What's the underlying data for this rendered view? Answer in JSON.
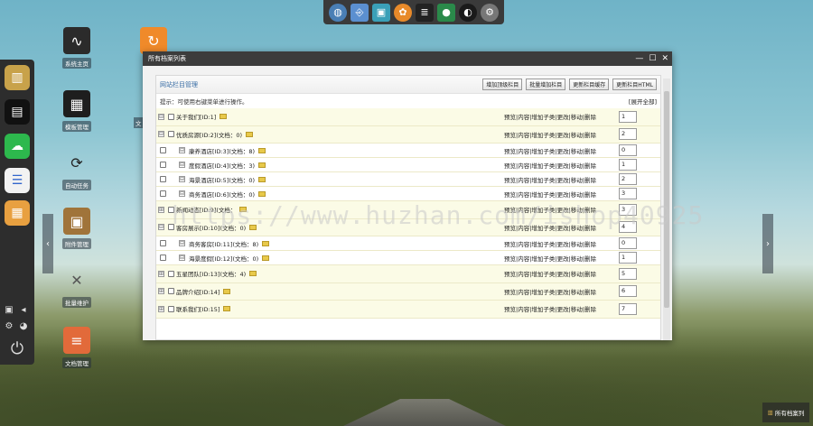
{
  "window": {
    "title": "所有档案列表",
    "controls": [
      "—",
      "☐",
      "✕"
    ]
  },
  "panel": {
    "title": "网站栏目管理",
    "buttons": [
      "增加顶级栏目",
      "批量增加栏目",
      "更新栏目缓存",
      "更新栏目HTML"
    ],
    "hint": "提示：可使用右键菜单进行操作。",
    "expand_all": "[展开全部]"
  },
  "rows": [
    {
      "type": "top",
      "exp": "⊟",
      "label": "关于我们[ID:1]",
      "actions": "预览|内容|增加子类|更改|移动|删除",
      "order": "1"
    },
    {
      "type": "top",
      "exp": "⊟",
      "label": "优质房源[ID:2](文档：0)",
      "actions": "预览|内容|增加子类|更改|移动|删除",
      "order": "2"
    },
    {
      "type": "sub",
      "exp": "⊟",
      "label": "康养酒店[ID:3](文档：8)",
      "actions": "预览|内容|增加子类|更改|移动|删除",
      "order": "0"
    },
    {
      "type": "sub",
      "exp": "⊟",
      "label": "度假酒店[ID:4](文档：3)",
      "actions": "预览|内容|增加子类|更改|移动|删除",
      "order": "1"
    },
    {
      "type": "sub",
      "exp": "⊟",
      "label": "海景酒店[ID:5](文档：0)",
      "actions": "预览|内容|增加子类|更改|移动|删除",
      "order": "2"
    },
    {
      "type": "sub",
      "exp": "⊟",
      "label": "商务酒店[ID:6](文档：0)",
      "actions": "预览|内容|增加子类|更改|移动|删除",
      "order": "3"
    },
    {
      "type": "top",
      "exp": "⊞",
      "label": "新闻动态[ID:9](文档：",
      "actions": "预览|内容|增加子类|更改|移动|删除",
      "order": "3"
    },
    {
      "type": "top",
      "exp": "⊟",
      "label": "客房展示[ID:10](文档：0)",
      "actions": "预览|内容|增加子类|更改|移动|删除",
      "order": "4"
    },
    {
      "type": "sub",
      "exp": "⊟",
      "label": "商务客房[ID:11](文档：8)",
      "actions": "预览|内容|增加子类|更改|移动|删除",
      "order": "0"
    },
    {
      "type": "sub",
      "exp": "⊟",
      "label": "海景度假[ID:12](文档：0)",
      "actions": "预览|内容|增加子类|更改|移动|删除",
      "order": "1"
    },
    {
      "type": "top",
      "exp": "⊞",
      "label": "五星团队[ID:13](文档：4)",
      "actions": "预览|内容|增加子类|更改|移动|删除",
      "order": "5"
    },
    {
      "type": "top",
      "exp": "⊞",
      "label": "品牌介绍[ID:14]",
      "actions": "预览|内容|增加子类|更改|移动|删除",
      "order": "6"
    },
    {
      "type": "top",
      "exp": "⊞",
      "label": "联系我们[ID:15]",
      "actions": "预览|内容|增加子类|更改|移动|删除",
      "order": "7"
    }
  ],
  "desktop": {
    "icons": [
      {
        "label": "系统主页",
        "icon": "pulse-icon",
        "color": "#2b2b2b"
      },
      {
        "label": "模板管理",
        "icon": "monitor-icon",
        "color": "#1e1e1e"
      },
      {
        "label": "自动任务",
        "icon": "sync-icon",
        "color": "#1e1e1e"
      },
      {
        "label": "附件管理",
        "icon": "package-icon",
        "color": "#a0743a"
      },
      {
        "label": "批量维护",
        "icon": "tools-icon",
        "color": "#6b6b6b"
      },
      {
        "label": "文档管理",
        "icon": "document-icon",
        "color": "#e26a3a"
      }
    ],
    "second_col_label_prefix": "文"
  },
  "watermark": "https://www.huzhan.com/ishop40925",
  "taskbar": {
    "label": "所有档案列"
  }
}
